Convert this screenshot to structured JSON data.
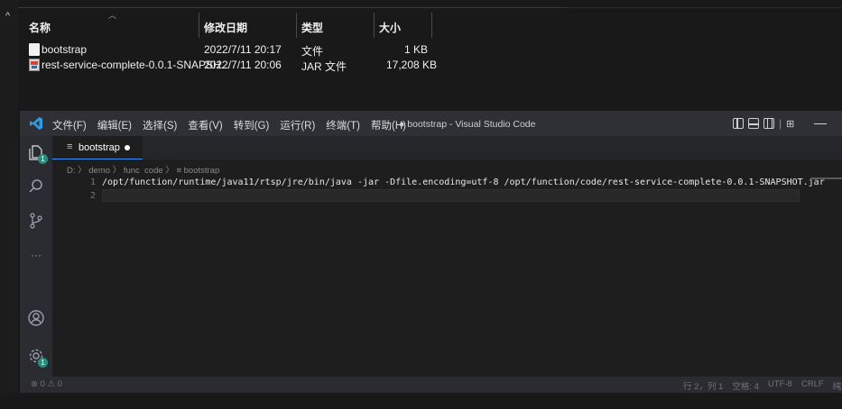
{
  "explorer": {
    "columns": [
      {
        "label": "名称"
      },
      {
        "label": "修改日期"
      },
      {
        "label": "类型"
      },
      {
        "label": "大小"
      }
    ],
    "files": [
      {
        "name": "bootstrap",
        "date": "2022/7/11 20:17",
        "type": "文件",
        "size": "1 KB",
        "icon": "file-icon"
      },
      {
        "name": "rest-service-complete-0.0.1-SNAPSH...",
        "date": "2022/7/11 20:06",
        "type": "JAR 文件",
        "size": "17,208 KB",
        "icon": "jar-file-icon"
      }
    ]
  },
  "vscode": {
    "menu": [
      "文件(F)",
      "编辑(E)",
      "选择(S)",
      "查看(V)",
      "转到(G)",
      "运行(R)",
      "终端(T)",
      "帮助(H)"
    ],
    "window_title": "● bootstrap - Visual Studio Code",
    "tab": {
      "icon": "≡",
      "label": "bootstrap"
    },
    "breadcrumb": "D: 〉 demo 〉 func_code 〉 ≡ bootstrap",
    "lines": [
      {
        "number": "1",
        "text": "/opt/function/runtime/java11/rtsp/jre/bin/java -jar -Dfile.encoding=utf-8 /opt/function/code/rest-service-complete-0.0.1-SNAPSHOT.jar"
      },
      {
        "number": "2",
        "text": ""
      }
    ],
    "activity_badges": {
      "explorer": "1",
      "settings": "1"
    },
    "status": {
      "problems": "⊗ 0 ⚠ 0",
      "position": "行 2，列 1",
      "spaces": "空格: 4",
      "encoding": "UTF-8",
      "eol": "CRLF",
      "language": "纯文本"
    },
    "colors": {
      "accent": "#3794ff",
      "badge": "#2a8c7c",
      "vscode_logo": "#2f9be6"
    }
  }
}
